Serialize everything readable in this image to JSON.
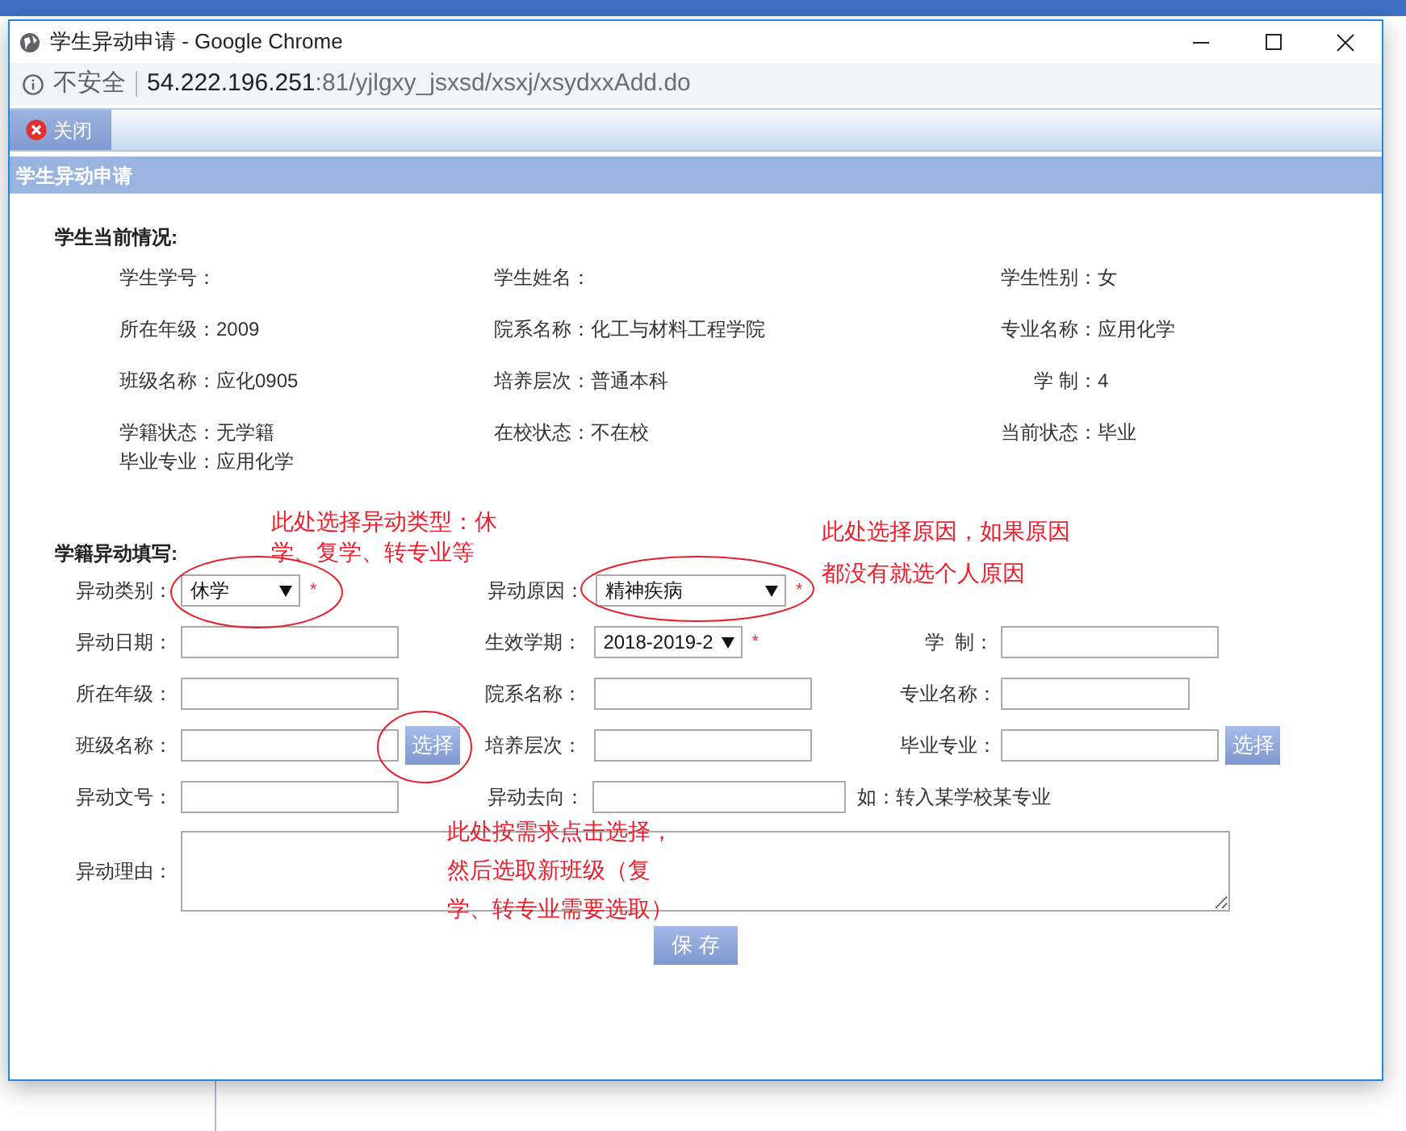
{
  "window": {
    "title": "学生异动申请 - Google Chrome",
    "address": {
      "security": "不安全",
      "host": "54.222.196.251",
      "path": ":81/yjlgxy_jsxsd/xsxj/xsydxxAdd.do"
    }
  },
  "toolbar": {
    "close_button": "关闭"
  },
  "panel_title": "学生异动申请",
  "current_info": {
    "heading": "学生当前情况:",
    "rows": [
      [
        {
          "label": "学生学号："
        },
        {
          "label": "学生姓名："
        },
        {
          "label": "学生性别：",
          "value": "女"
        }
      ],
      [
        {
          "label": "所在年级：",
          "value": "2009"
        },
        {
          "label": "院系名称：",
          "value": "化工与材料工程学院"
        },
        {
          "label": "专业名称：",
          "value": "应用化学"
        }
      ],
      [
        {
          "label": "班级名称：",
          "value": "应化0905"
        },
        {
          "label": "培养层次：",
          "value": "普通本科"
        },
        {
          "label": "学 制：",
          "value": "4"
        }
      ],
      [
        {
          "label": "学籍状态：",
          "value": "无学籍"
        },
        {
          "label": "在校状态：",
          "value": "不在校"
        },
        {
          "label": "当前状态：",
          "value": "毕业"
        }
      ],
      [
        {
          "label": "毕业专业：",
          "value": "应用化学"
        }
      ]
    ]
  },
  "form": {
    "heading": "学籍异动填写:",
    "rows": [
      [
        {
          "kind": "select",
          "label": "异动类别：",
          "value": "休学",
          "mark": "*"
        },
        {
          "kind": "select",
          "label": "异动原因：",
          "value": "精神疾病",
          "mark": "*"
        }
      ],
      [
        {
          "kind": "text",
          "label": "异动日期："
        },
        {
          "kind": "select",
          "label": "生效学期：",
          "value": "2018-2019-2",
          "mark": "*"
        },
        {
          "kind": "text",
          "label": "学  制："
        }
      ],
      [
        {
          "kind": "text",
          "label": "所在年级："
        },
        {
          "kind": "text",
          "label": "院系名称："
        },
        {
          "kind": "text",
          "label": "专业名称："
        }
      ],
      [
        {
          "kind": "text",
          "label": "班级名称：",
          "button": "选择"
        },
        {
          "kind": "text",
          "label": "培养层次："
        },
        {
          "kind": "text",
          "label": "毕业专业：",
          "button": "选择"
        }
      ],
      [
        {
          "kind": "text",
          "label": "异动文号："
        },
        {
          "kind": "text",
          "label": "异动去向：",
          "hint": "如：转入某学校某专业"
        }
      ],
      [
        {
          "kind": "textarea",
          "label": "异动理由："
        }
      ]
    ]
  },
  "save_button": "保 存",
  "annotations": [
    [
      "此处选择异动类型：休",
      "学、复学、转专业等"
    ],
    [
      "此处选择原因，如果原因",
      "都没有就选个人原因"
    ],
    [
      "此处按需求点击选择，",
      "然后选取新班级（复",
      "学、转专业需要选取）"
    ]
  ]
}
